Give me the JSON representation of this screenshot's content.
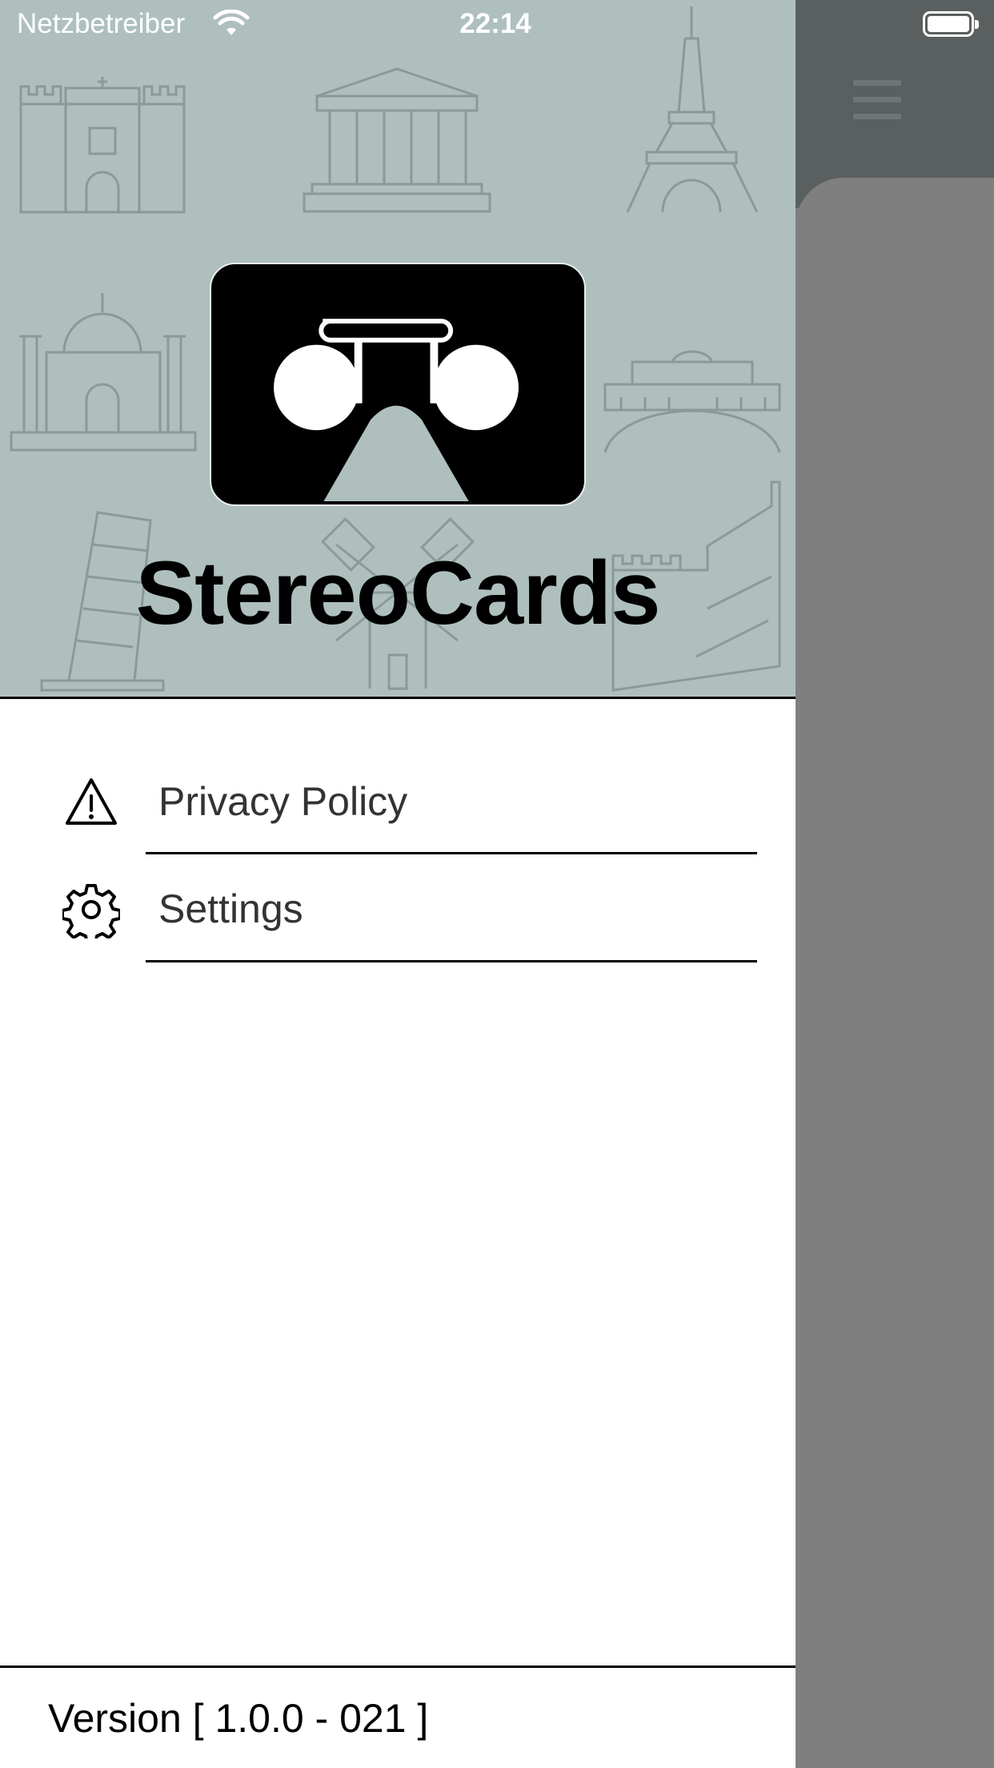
{
  "status_bar": {
    "carrier": "Netzbetreiber",
    "time": "22:14"
  },
  "drawer": {
    "app_title": "StereoCards",
    "menu": [
      {
        "label": "Privacy Policy",
        "icon": "warning-triangle-icon"
      },
      {
        "label": "Settings",
        "icon": "gear-icon"
      }
    ],
    "version_text": "Version [ 1.0.0 - 021 ]"
  },
  "colors": {
    "header_background": "#aebfbe",
    "landmark_stroke": "#8a9a99",
    "overlay": "#7f7f7f",
    "main_topbar": "#5a605f"
  }
}
